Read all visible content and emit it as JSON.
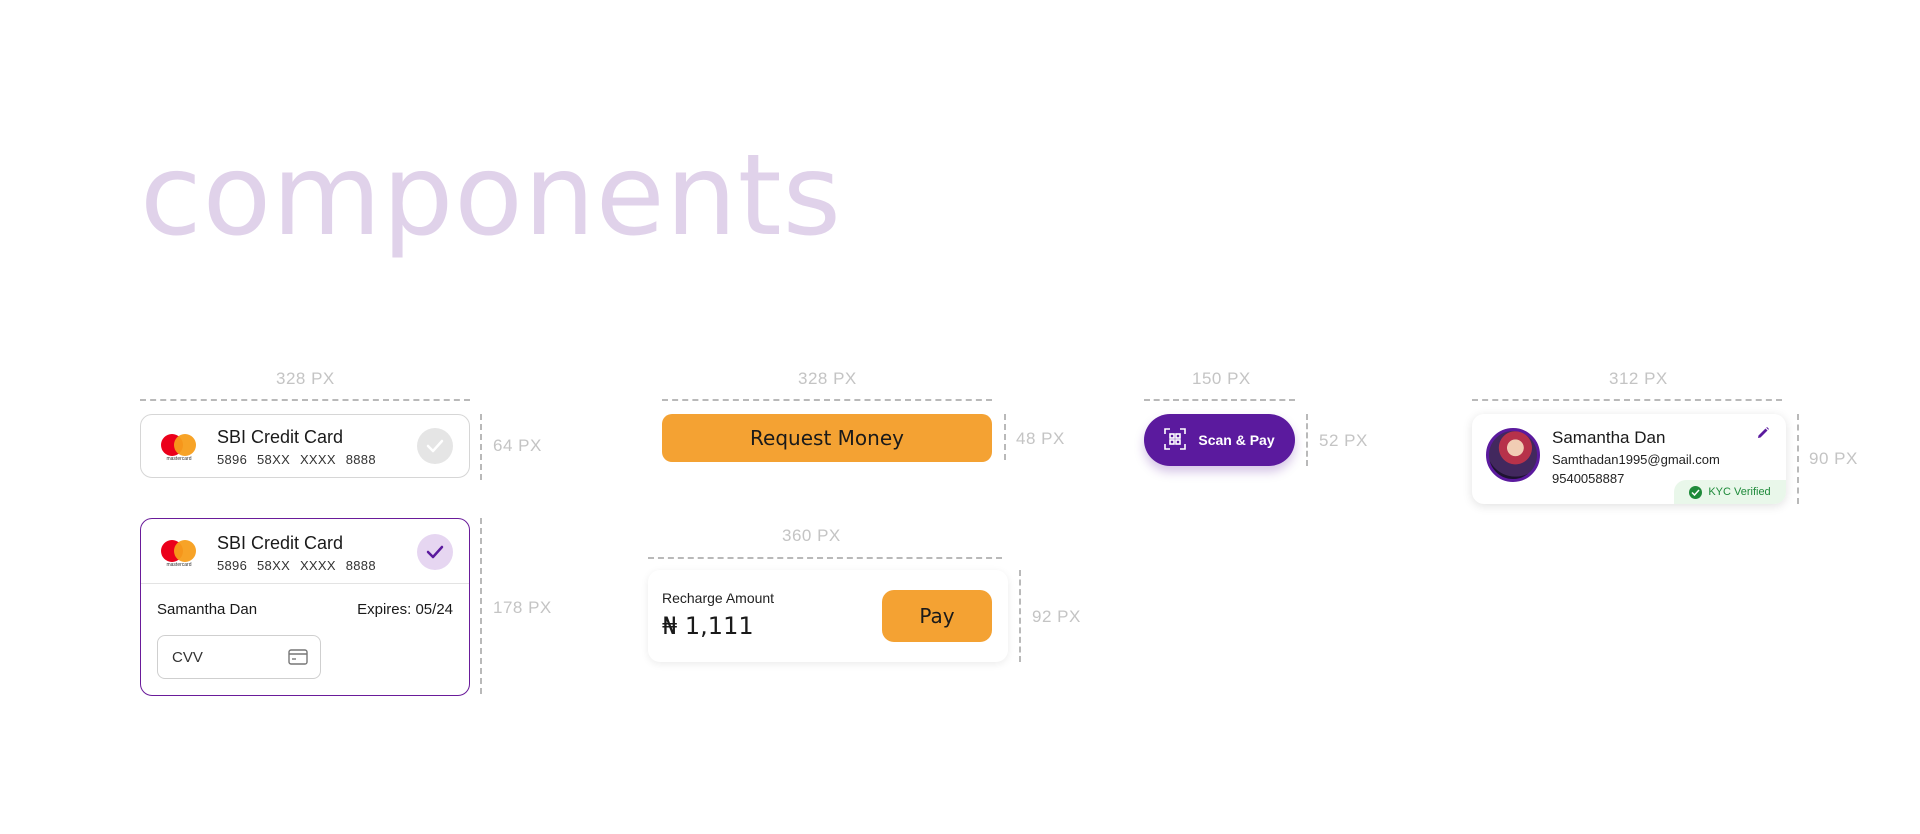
{
  "page": {
    "title": "components"
  },
  "dimensions": {
    "card_width": "328 PX",
    "card_height": "64 PX",
    "expanded_height": "178 PX",
    "request_width": "328 PX",
    "request_height": "48 PX",
    "recharge_width": "360 PX",
    "recharge_height": "92 PX",
    "scan_width": "150 PX",
    "scan_height": "52 PX",
    "profile_width": "312 PX",
    "profile_height": "90 PX"
  },
  "card_collapsed": {
    "name": "SBI Credit Card",
    "number": "5896 58XX XXXX 8888",
    "logo_text": "mastercard"
  },
  "card_expanded": {
    "name": "SBI Credit Card",
    "number": "5896 58XX XXXX 8888",
    "logo_text": "mastercard",
    "holder": "Samantha Dan",
    "expires": "Expires: 05/24",
    "cvv_placeholder": "CVV"
  },
  "request_button": {
    "label": "Request Money"
  },
  "recharge": {
    "label": "Recharge Amount",
    "amount": "₦ 1,111",
    "pay_label": "Pay"
  },
  "scan_button": {
    "label": "Scan & Pay"
  },
  "profile": {
    "name": "Samantha Dan",
    "email": "Samthadan1995@gmail.com",
    "phone": "9540058887",
    "badge": "KYC Verified"
  },
  "colors": {
    "orange": "#f4a233",
    "purple": "#5b1a9e",
    "title": "#e0d2ea",
    "verified_green": "#1e8a3a"
  }
}
